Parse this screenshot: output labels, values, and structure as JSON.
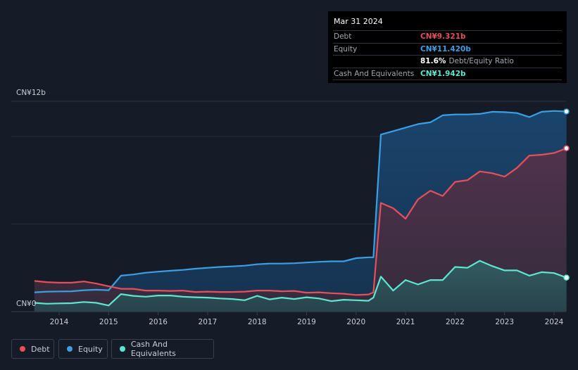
{
  "tooltip": {
    "date": "Mar 31 2024",
    "rows": [
      {
        "label": "Debt",
        "value": "CN¥9.321b",
        "color": "#e5505a"
      },
      {
        "label": "Equity",
        "value": "CN¥11.420b",
        "color": "#3b9fe3"
      },
      {
        "label": "",
        "value": "81.6%",
        "extra": "Debt/Equity Ratio",
        "color": "#ffffff"
      },
      {
        "label": "Cash And Equivalents",
        "value": "CN¥1.942b",
        "color": "#5ee6d1"
      }
    ]
  },
  "legend": {
    "items": [
      {
        "label": "Debt",
        "color": "#e5505a"
      },
      {
        "label": "Equity",
        "color": "#3b9fe3"
      },
      {
        "label": "Cash And Equivalents",
        "color": "#5ee6d1"
      }
    ]
  },
  "chart_data": {
    "type": "area",
    "y_top_label": "CN¥12b",
    "y_zero_label": "CN¥0",
    "ylim": [
      0,
      12
    ],
    "xlim": [
      2013.5,
      2024.25
    ],
    "x_ticks": [
      2014,
      2015,
      2016,
      2017,
      2018,
      2019,
      2020,
      2021,
      2022,
      2023,
      2024
    ],
    "x_tick_labels": [
      "2014",
      "2015",
      "2016",
      "2017",
      "2018",
      "2019",
      "2020",
      "2021",
      "2022",
      "2023",
      "2024"
    ],
    "grid": true,
    "series": [
      {
        "name": "Equity",
        "color": "#3b9fe3",
        "points": [
          [
            2013.5,
            1.1
          ],
          [
            2013.75,
            1.14
          ],
          [
            2014,
            1.15
          ],
          [
            2014.25,
            1.16
          ],
          [
            2014.5,
            1.22
          ],
          [
            2014.75,
            1.25
          ],
          [
            2015,
            1.22
          ],
          [
            2015.25,
            2.05
          ],
          [
            2015.5,
            2.12
          ],
          [
            2015.75,
            2.22
          ],
          [
            2016,
            2.28
          ],
          [
            2016.25,
            2.33
          ],
          [
            2016.5,
            2.38
          ],
          [
            2016.75,
            2.45
          ],
          [
            2017,
            2.5
          ],
          [
            2017.25,
            2.55
          ],
          [
            2017.5,
            2.58
          ],
          [
            2017.75,
            2.62
          ],
          [
            2018,
            2.7
          ],
          [
            2018.25,
            2.74
          ],
          [
            2018.5,
            2.74
          ],
          [
            2018.75,
            2.76
          ],
          [
            2019,
            2.8
          ],
          [
            2019.25,
            2.84
          ],
          [
            2019.5,
            2.87
          ],
          [
            2019.75,
            2.87
          ],
          [
            2020,
            3.05
          ],
          [
            2020.25,
            3.1
          ],
          [
            2020.35,
            3.1
          ],
          [
            2020.5,
            10.1
          ],
          [
            2020.75,
            10.3
          ],
          [
            2021,
            10.5
          ],
          [
            2021.25,
            10.7
          ],
          [
            2021.5,
            10.8
          ],
          [
            2021.75,
            11.2
          ],
          [
            2022,
            11.25
          ],
          [
            2022.25,
            11.25
          ],
          [
            2022.5,
            11.28
          ],
          [
            2022.75,
            11.4
          ],
          [
            2023,
            11.38
          ],
          [
            2023.25,
            11.33
          ],
          [
            2023.5,
            11.1
          ],
          [
            2023.75,
            11.4
          ],
          [
            2024,
            11.45
          ],
          [
            2024.25,
            11.42
          ]
        ]
      },
      {
        "name": "Debt",
        "color": "#e5505a",
        "points": [
          [
            2013.5,
            1.75
          ],
          [
            2013.75,
            1.68
          ],
          [
            2014,
            1.65
          ],
          [
            2014.25,
            1.65
          ],
          [
            2014.5,
            1.72
          ],
          [
            2014.75,
            1.6
          ],
          [
            2015,
            1.45
          ],
          [
            2015.25,
            1.3
          ],
          [
            2015.5,
            1.3
          ],
          [
            2015.75,
            1.2
          ],
          [
            2016,
            1.2
          ],
          [
            2016.25,
            1.18
          ],
          [
            2016.5,
            1.2
          ],
          [
            2016.75,
            1.12
          ],
          [
            2017,
            1.14
          ],
          [
            2017.25,
            1.12
          ],
          [
            2017.5,
            1.12
          ],
          [
            2017.75,
            1.14
          ],
          [
            2018,
            1.2
          ],
          [
            2018.25,
            1.2
          ],
          [
            2018.5,
            1.16
          ],
          [
            2018.75,
            1.18
          ],
          [
            2019,
            1.08
          ],
          [
            2019.25,
            1.1
          ],
          [
            2019.5,
            1.05
          ],
          [
            2019.75,
            1.02
          ],
          [
            2020,
            0.95
          ],
          [
            2020.25,
            0.98
          ],
          [
            2020.35,
            1.1
          ],
          [
            2020.5,
            6.2
          ],
          [
            2020.75,
            5.9
          ],
          [
            2021,
            5.3
          ],
          [
            2021.25,
            6.4
          ],
          [
            2021.5,
            6.9
          ],
          [
            2021.75,
            6.6
          ],
          [
            2022,
            7.4
          ],
          [
            2022.25,
            7.5
          ],
          [
            2022.5,
            8.0
          ],
          [
            2022.75,
            7.9
          ],
          [
            2023,
            7.7
          ],
          [
            2023.25,
            8.2
          ],
          [
            2023.5,
            8.9
          ],
          [
            2023.75,
            8.95
          ],
          [
            2024,
            9.05
          ],
          [
            2024.25,
            9.32
          ]
        ]
      },
      {
        "name": "Cash And Equivalents",
        "color": "#5ee6d1",
        "points": [
          [
            2013.5,
            0.5
          ],
          [
            2013.75,
            0.45
          ],
          [
            2014,
            0.47
          ],
          [
            2014.25,
            0.48
          ],
          [
            2014.5,
            0.55
          ],
          [
            2014.75,
            0.5
          ],
          [
            2015,
            0.35
          ],
          [
            2015.25,
            1.0
          ],
          [
            2015.5,
            0.9
          ],
          [
            2015.75,
            0.85
          ],
          [
            2016,
            0.92
          ],
          [
            2016.25,
            0.92
          ],
          [
            2016.5,
            0.85
          ],
          [
            2016.75,
            0.82
          ],
          [
            2017,
            0.8
          ],
          [
            2017.25,
            0.75
          ],
          [
            2017.5,
            0.72
          ],
          [
            2017.75,
            0.65
          ],
          [
            2018,
            0.9
          ],
          [
            2018.25,
            0.7
          ],
          [
            2018.5,
            0.8
          ],
          [
            2018.75,
            0.72
          ],
          [
            2019,
            0.82
          ],
          [
            2019.25,
            0.75
          ],
          [
            2019.5,
            0.6
          ],
          [
            2019.75,
            0.68
          ],
          [
            2020,
            0.65
          ],
          [
            2020.25,
            0.62
          ],
          [
            2020.35,
            0.8
          ],
          [
            2020.5,
            2.0
          ],
          [
            2020.75,
            1.2
          ],
          [
            2021,
            1.8
          ],
          [
            2021.25,
            1.55
          ],
          [
            2021.5,
            1.8
          ],
          [
            2021.75,
            1.8
          ],
          [
            2022,
            2.55
          ],
          [
            2022.25,
            2.5
          ],
          [
            2022.5,
            2.9
          ],
          [
            2022.75,
            2.6
          ],
          [
            2023,
            2.35
          ],
          [
            2023.25,
            2.35
          ],
          [
            2023.5,
            2.05
          ],
          [
            2023.75,
            2.25
          ],
          [
            2024,
            2.2
          ],
          [
            2024.25,
            1.94
          ]
        ]
      }
    ]
  }
}
